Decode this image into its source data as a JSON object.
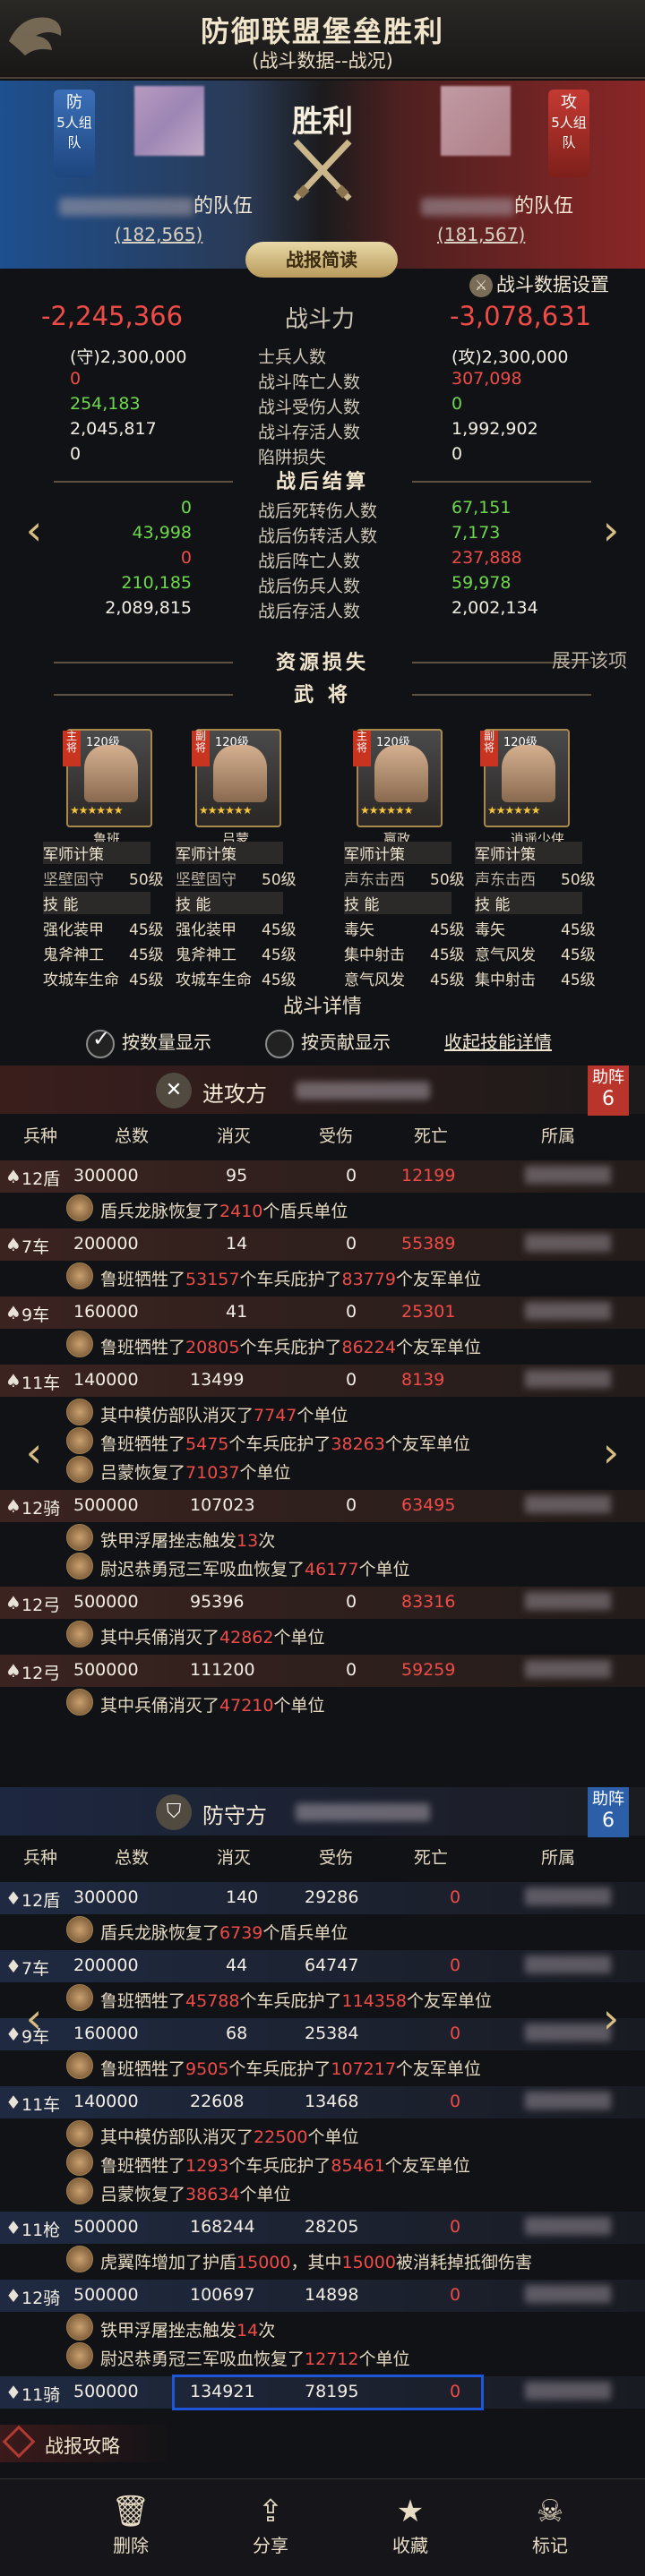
{
  "header": {
    "title": "防御联盟堡垒胜利",
    "subtitle": "(战斗数据--战况)"
  },
  "banner": {
    "result": "胜利",
    "left": {
      "badge": "5人组队",
      "badge_char": "防",
      "team_suffix": "的队伍",
      "power": "(182,565)"
    },
    "right": {
      "badge": "5人组队",
      "badge_char": "攻",
      "team_suffix": "的队伍",
      "power": "(181,567)"
    },
    "brief_button": "战报简读",
    "settings": "战斗数据设置"
  },
  "colors": {
    "red": "#ef4b47",
    "green": "#6ed84d",
    "gold": "#e6c58a",
    "attack": "#ec5a4a",
    "defend": "#5c92e0"
  },
  "battle_stats": {
    "power": {
      "left": "-2,245,366",
      "label": "战斗力",
      "right": "-3,078,631"
    },
    "rows": [
      {
        "left": "(守)2,300,000",
        "label": "士兵人数",
        "right": "(攻)2,300,000",
        "lc": "wht",
        "rc": "wht"
      },
      {
        "left": "0",
        "label": "战斗阵亡人数",
        "right": "307,098",
        "lc": "red",
        "rc": "red"
      },
      {
        "left": "254,183",
        "label": "战斗受伤人数",
        "right": "0",
        "lc": "grn",
        "rc": "grn"
      },
      {
        "left": "2,045,817",
        "label": "战斗存活人数",
        "right": "1,992,902",
        "lc": "wht",
        "rc": "wht"
      },
      {
        "left": "0",
        "label": "陷阱损失",
        "right": "0",
        "lc": "wht",
        "rc": "wht"
      }
    ]
  },
  "after_battle": {
    "title": "战后结算",
    "rows": [
      {
        "left": "0",
        "label": "战后死转伤人数",
        "right": "67,151",
        "lc": "grn",
        "rc": "grn"
      },
      {
        "left": "43,998",
        "label": "战后伤转活人数",
        "right": "7,173",
        "lc": "grn",
        "rc": "grn"
      },
      {
        "left": "0",
        "label": "战后阵亡人数",
        "right": "237,888",
        "lc": "red",
        "rc": "red"
      },
      {
        "left": "210,185",
        "label": "战后伤兵人数",
        "right": "59,978",
        "lc": "grn",
        "rc": "grn"
      },
      {
        "left": "2,089,815",
        "label": "战后存活人数",
        "right": "2,002,134",
        "lc": "wht",
        "rc": "wht"
      }
    ]
  },
  "resources": {
    "title": "资源损失",
    "expand": "展开该项"
  },
  "generals": {
    "title": "武 将",
    "heroes": [
      {
        "name": "鲁班",
        "level": "120级",
        "tag": "主将",
        "stars": "★★★★★★"
      },
      {
        "name": "吕蒙",
        "level": "120级",
        "tag": "副将",
        "stars": "★★★★★★"
      },
      {
        "name": "嬴政",
        "level": "120级",
        "tag": "主将",
        "stars": "★★★★★★"
      },
      {
        "name": "逍遥少侠",
        "level": "120级",
        "tag": "副将",
        "stars": "★★★★★★"
      }
    ],
    "skills": [
      {
        "h1": "军师计策",
        "s": [
          [
            "坚壁固守",
            "50级"
          ]
        ],
        "h2": "技 能",
        "t": [
          [
            "强化装甲",
            "45级"
          ],
          [
            "鬼斧神工",
            "45级"
          ],
          [
            "攻城车生命",
            "45级"
          ]
        ]
      },
      {
        "h1": "军师计策",
        "s": [
          [
            "坚壁固守",
            "50级"
          ]
        ],
        "h2": "技 能",
        "t": [
          [
            "强化装甲",
            "45级"
          ],
          [
            "鬼斧神工",
            "45级"
          ],
          [
            "攻城车生命",
            "45级"
          ]
        ]
      },
      {
        "h1": "军师计策",
        "s": [
          [
            "声东击西",
            "50级"
          ]
        ],
        "h2": "技 能",
        "t": [
          [
            "毒矢",
            "45级"
          ],
          [
            "集中射击",
            "45级"
          ],
          [
            "意气风发",
            "45级"
          ]
        ]
      },
      {
        "h1": "军师计策",
        "s": [
          [
            "声东击西",
            "50级"
          ]
        ],
        "h2": "技 能",
        "t": [
          [
            "毒矢",
            "45级"
          ],
          [
            "意气风发",
            "45级"
          ],
          [
            "集中射击",
            "45级"
          ]
        ]
      }
    ]
  },
  "details": {
    "title": "战斗详情",
    "by_unit": "按数量显示",
    "by_contrib": "按贡献显示",
    "collapse": "收起技能详情"
  },
  "attack": {
    "label": "进攻方",
    "help": "助阵",
    "help_n": "6",
    "headers": [
      "兵种",
      "总数",
      "消灭",
      "受伤",
      "死亡",
      "所属"
    ],
    "units": [
      {
        "type": "12盾",
        "total": "300000",
        "kill": "95",
        "wound": "0",
        "death": "12199",
        "notes": [
          [
            "盾兵龙脉恢复了",
            "2410",
            "个盾兵单位",
            ""
          ]
        ]
      },
      {
        "type": "7车",
        "total": "200000",
        "kill": "14",
        "wound": "0",
        "death": "55389",
        "notes": [
          [
            "鲁班牺牲了",
            "53157",
            "个车兵庇护了",
            "83779",
            "个友军单位"
          ]
        ]
      },
      {
        "type": "9车",
        "total": "160000",
        "kill": "41",
        "wound": "0",
        "death": "25301",
        "notes": [
          [
            "鲁班牺牲了",
            "20805",
            "个车兵庇护了",
            "86224",
            "个友军单位"
          ]
        ]
      },
      {
        "type": "11车",
        "total": "140000",
        "kill": "13499",
        "wound": "0",
        "death": "8139",
        "notes": [
          [
            "其中模仿部队消灭了",
            "7747",
            "个单位",
            ""
          ],
          [
            "鲁班牺牲了",
            "5475",
            "个车兵庇护了",
            "38263",
            "个友军单位"
          ],
          [
            "吕蒙恢复了",
            "71037",
            "个单位",
            ""
          ]
        ]
      },
      {
        "type": "12骑",
        "total": "500000",
        "kill": "107023",
        "wound": "0",
        "death": "63495",
        "notes": [
          [
            "铁甲浮屠挫志触发",
            "13",
            "次",
            ""
          ],
          [
            "尉迟恭勇冠三军吸血恢复了",
            "46177",
            "个单位",
            ""
          ]
        ]
      },
      {
        "type": "12弓",
        "total": "500000",
        "kill": "95396",
        "wound": "0",
        "death": "83316",
        "notes": [
          [
            "其中兵俑消灭了",
            "42862",
            "个单位",
            ""
          ]
        ]
      },
      {
        "type": "12弓",
        "total": "500000",
        "kill": "111200",
        "wound": "0",
        "death": "59259",
        "notes": [
          [
            "其中兵俑消灭了",
            "47210",
            "个单位",
            ""
          ]
        ]
      }
    ]
  },
  "defend": {
    "label": "防守方",
    "help": "助阵",
    "help_n": "6",
    "headers": [
      "兵种",
      "总数",
      "消灭",
      "受伤",
      "死亡",
      "所属"
    ],
    "units": [
      {
        "type": "12盾",
        "total": "300000",
        "kill": "140",
        "wound": "29286",
        "death": "0",
        "notes": [
          [
            "盾兵龙脉恢复了",
            "6739",
            "个盾兵单位",
            ""
          ]
        ]
      },
      {
        "type": "7车",
        "total": "200000",
        "kill": "44",
        "wound": "64747",
        "death": "0",
        "notes": [
          [
            "鲁班牺牲了",
            "45788",
            "个车兵庇护了",
            "114358",
            "个友军单位"
          ]
        ]
      },
      {
        "type": "9车",
        "total": "160000",
        "kill": "68",
        "wound": "25384",
        "death": "0",
        "notes": [
          [
            "鲁班牺牲了",
            "9505",
            "个车兵庇护了",
            "107217",
            "个友军单位"
          ]
        ]
      },
      {
        "type": "11车",
        "total": "140000",
        "kill": "22608",
        "wound": "13468",
        "death": "0",
        "notes": [
          [
            "其中模仿部队消灭了",
            "22500",
            "个单位",
            ""
          ],
          [
            "鲁班牺牲了",
            "1293",
            "个车兵庇护了",
            "85461",
            "个友军单位"
          ],
          [
            "吕蒙恢复了",
            "38634",
            "个单位",
            ""
          ]
        ]
      },
      {
        "type": "11枪",
        "total": "500000",
        "kill": "168244",
        "wound": "28205",
        "death": "0",
        "notes": [
          [
            "虎翼阵增加了护盾",
            "15000",
            "，其中",
            "15000",
            "被消耗掉抵御伤害"
          ]
        ]
      },
      {
        "type": "12骑",
        "total": "500000",
        "kill": "100697",
        "wound": "14898",
        "death": "0",
        "notes": [
          [
            "铁甲浮屠挫志触发",
            "14",
            "次",
            ""
          ],
          [
            "尉迟恭勇冠三军吸血恢复了",
            "12712",
            "个单位",
            ""
          ]
        ]
      },
      {
        "type": "11骑",
        "total": "500000",
        "kill": "134921",
        "wound": "78195",
        "death": "0",
        "notes": []
      }
    ]
  },
  "report_guide": "战报攻略",
  "tabs": [
    {
      "label": "删除",
      "icon": "trash-icon"
    },
    {
      "label": "分享",
      "icon": "share-icon"
    },
    {
      "label": "收藏",
      "icon": "star-icon"
    },
    {
      "label": "标记",
      "icon": "skull-icon"
    }
  ]
}
